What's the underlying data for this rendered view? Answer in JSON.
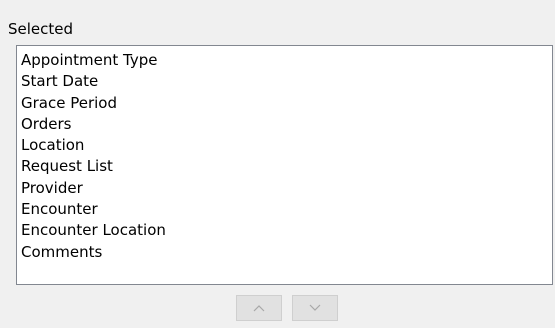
{
  "panel": {
    "label": "Selected"
  },
  "selected_list": {
    "items": [
      "Appointment Type",
      "Start Date",
      "Grace Period",
      "Orders",
      "Location",
      "Request List",
      "Provider",
      "Encounter",
      "Encounter Location",
      "Comments"
    ]
  },
  "controls": {
    "move_up_icon": "chevron-up-icon",
    "move_down_icon": "chevron-down-icon",
    "enabled": false
  }
}
